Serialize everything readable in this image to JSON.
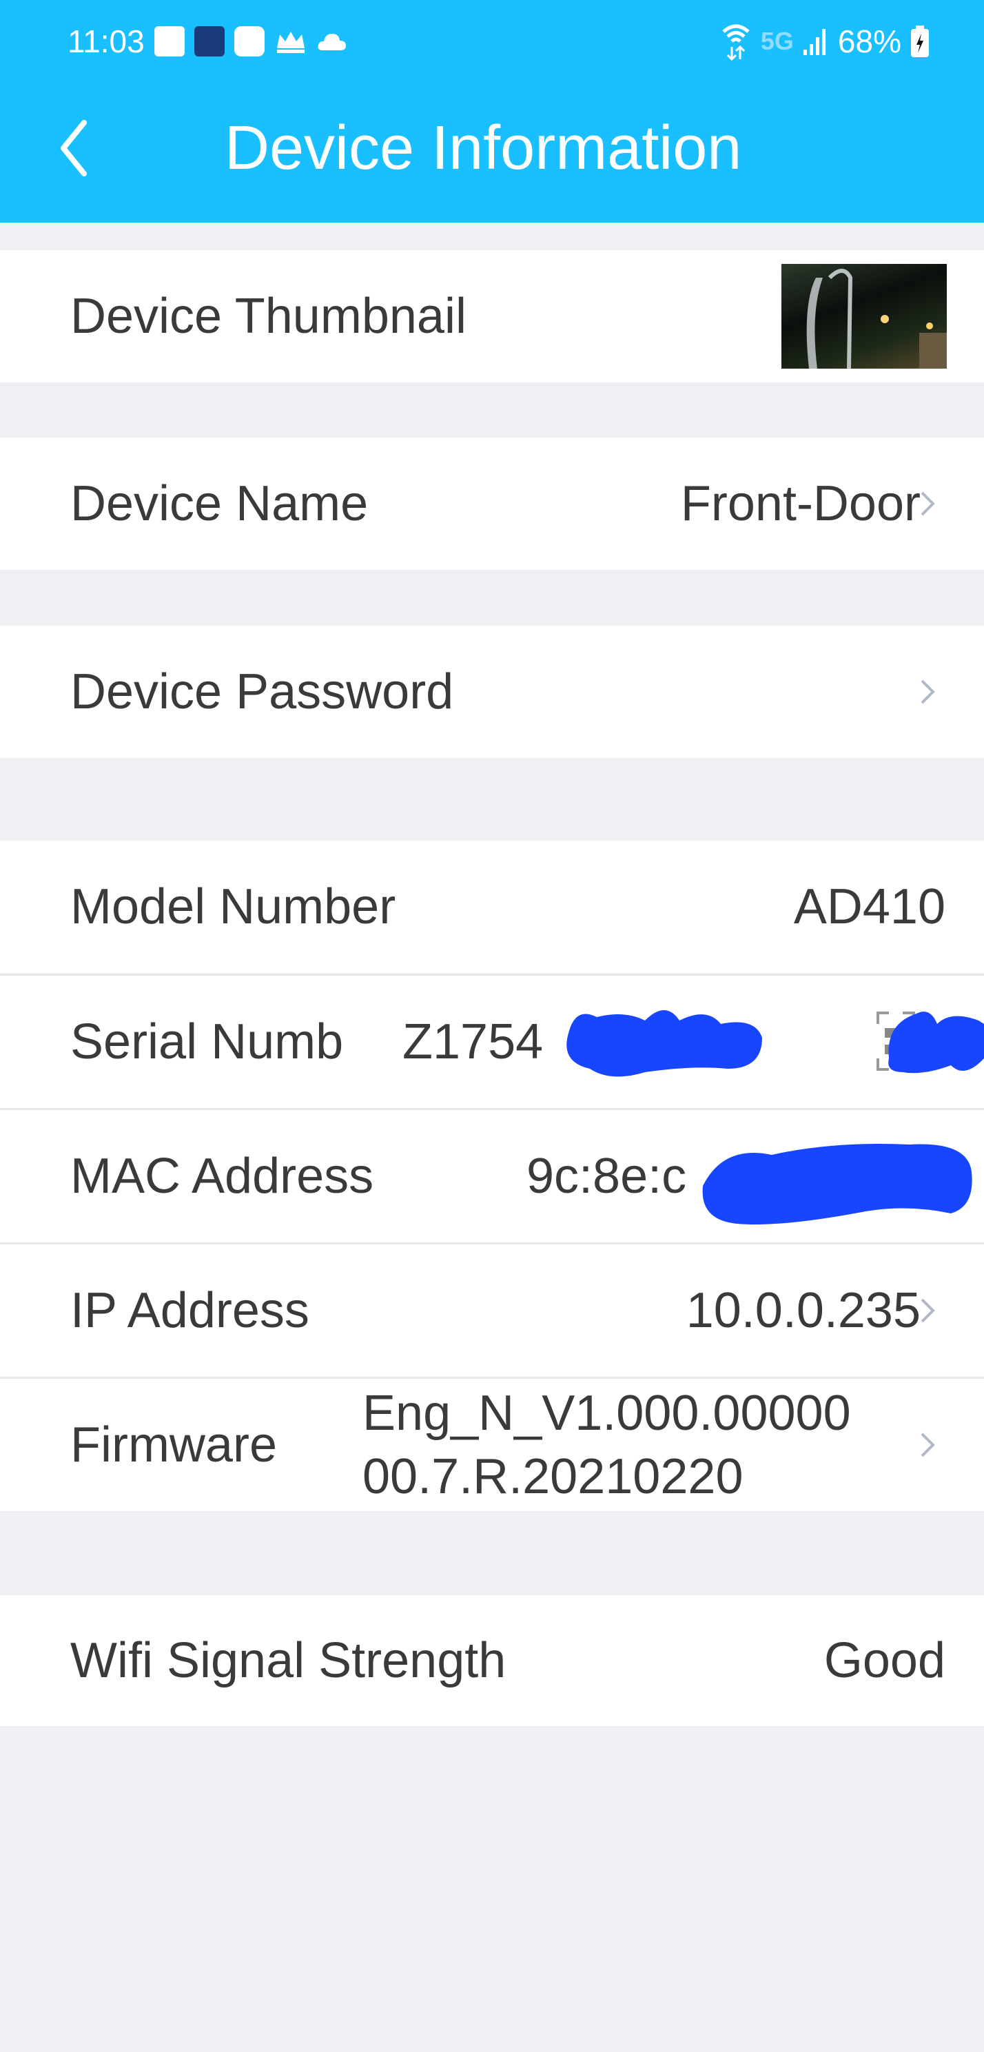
{
  "status_bar": {
    "time": "11:03",
    "network": "5G",
    "battery": "68%",
    "icons": [
      "news-icon",
      "camera-app-icon",
      "youtube-icon",
      "royal-match-icon",
      "cloud-icon",
      "wifi-icon",
      "signal-icon",
      "battery-charging-icon"
    ]
  },
  "header": {
    "title": "Device Information",
    "back_icon": "chevron-left-icon"
  },
  "colors": {
    "header": "#19bfff",
    "background": "#efeff4",
    "redaction": "#1846ff"
  },
  "rows": {
    "thumbnail": {
      "label": "Device Thumbnail"
    },
    "name": {
      "label": "Device Name",
      "value": "Front-Door"
    },
    "password": {
      "label": "Device Password"
    },
    "model": {
      "label": "Model Number",
      "value": "AD410"
    },
    "serial": {
      "label": "Serial Numb",
      "value": "Z1754"
    },
    "mac": {
      "label": "MAC Address",
      "value": "9c:8e:c"
    },
    "ip": {
      "label": "IP Address",
      "value": "10.0.0.235"
    },
    "firmware": {
      "label": "Firmware",
      "value_line1": "Eng_N_V1.000.00000",
      "value_line2": "00.7.R.20210220"
    },
    "wifi": {
      "label": "Wifi Signal Strength",
      "value": "Good"
    }
  }
}
